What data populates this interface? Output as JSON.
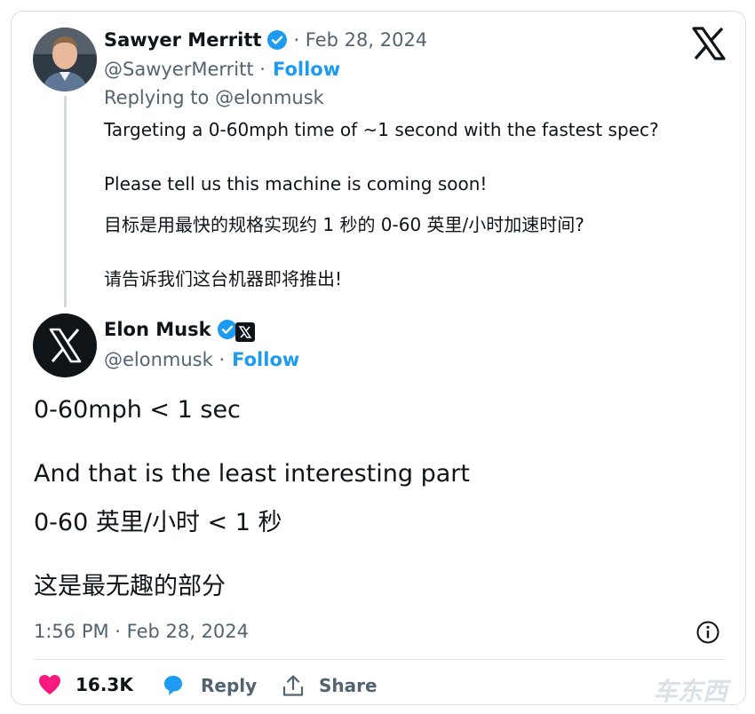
{
  "reply_tweet": {
    "author_name": "Sawyer Merritt",
    "separator_date": "· Feb 28, 2024",
    "handle": "@SawyerMerritt ·",
    "follow_label": "Follow",
    "replying_to": "Replying to @elonmusk",
    "lines": [
      "Targeting a 0-60mph time of ~1 second with the fastest spec?",
      "Please tell us this machine is coming soon!",
      "目标是用最快的规格实现约 1 秒的 0-60 英里/小时加速时间?",
      "请告诉我们这台机器即将推出!"
    ]
  },
  "main_tweet": {
    "author_name": "Elon Musk",
    "handle": "@elonmusk ·",
    "follow_label": "Follow",
    "lines": [
      "0-60mph < 1 sec",
      "And that is the least interesting part",
      "0-60 英里/小时 < 1 秒",
      "这是最无趣的部分"
    ],
    "timestamp": "1:56 PM · Feb 28, 2024"
  },
  "actions": {
    "likes": "16.3K",
    "reply_label": "Reply",
    "share_label": "Share"
  },
  "watermark": "车东西",
  "icons": {
    "platform": "x-logo-icon",
    "verified": "verified-badge-icon",
    "info": "info-icon",
    "like": "heart-icon",
    "reply": "reply-bubble-icon",
    "share": "share-icon"
  },
  "colors": {
    "accent": "#1d9bf0",
    "like": "#f91880",
    "text": "#0f1419",
    "muted": "#536471"
  }
}
